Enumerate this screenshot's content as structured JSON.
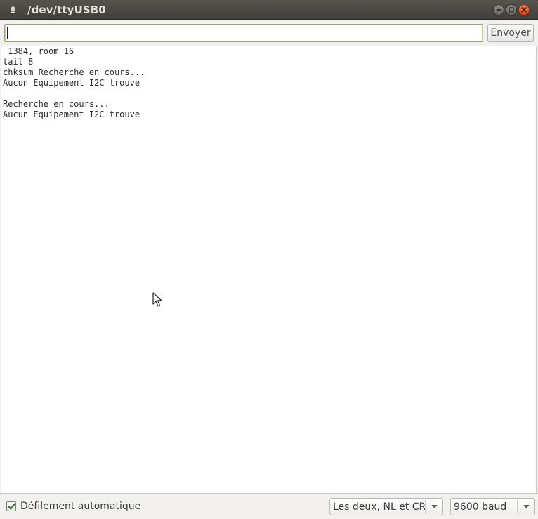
{
  "window": {
    "title": "/dev/ttyUSB0"
  },
  "toolbar": {
    "input_value": "",
    "send_label": "Envoyer"
  },
  "output": {
    "lines": [
      " 1384, room 16",
      "tail 8",
      "chksum Recherche en cours...",
      "Aucun Equipement I2C trouve",
      "",
      "Recherche en cours...",
      "Aucun Equipement I2C trouve"
    ]
  },
  "statusbar": {
    "autoscroll_label": "Défilement automatique",
    "autoscroll_checked": true,
    "line_ending_selected": "Les deux, NL et CR",
    "baud_selected": "9600 baud"
  },
  "colors": {
    "titlebar": "#4a4944",
    "close_button": "#e5531c",
    "checkbox_check": "#3d7a3d"
  },
  "icons": {
    "title": "window-menu-icon",
    "minimize": "minimize-icon",
    "maximize": "maximize-icon",
    "close": "close-icon",
    "checkbox": "checkmark-icon",
    "dropdown": "chevron-down-icon",
    "pointer": "mouse-pointer-icon"
  }
}
